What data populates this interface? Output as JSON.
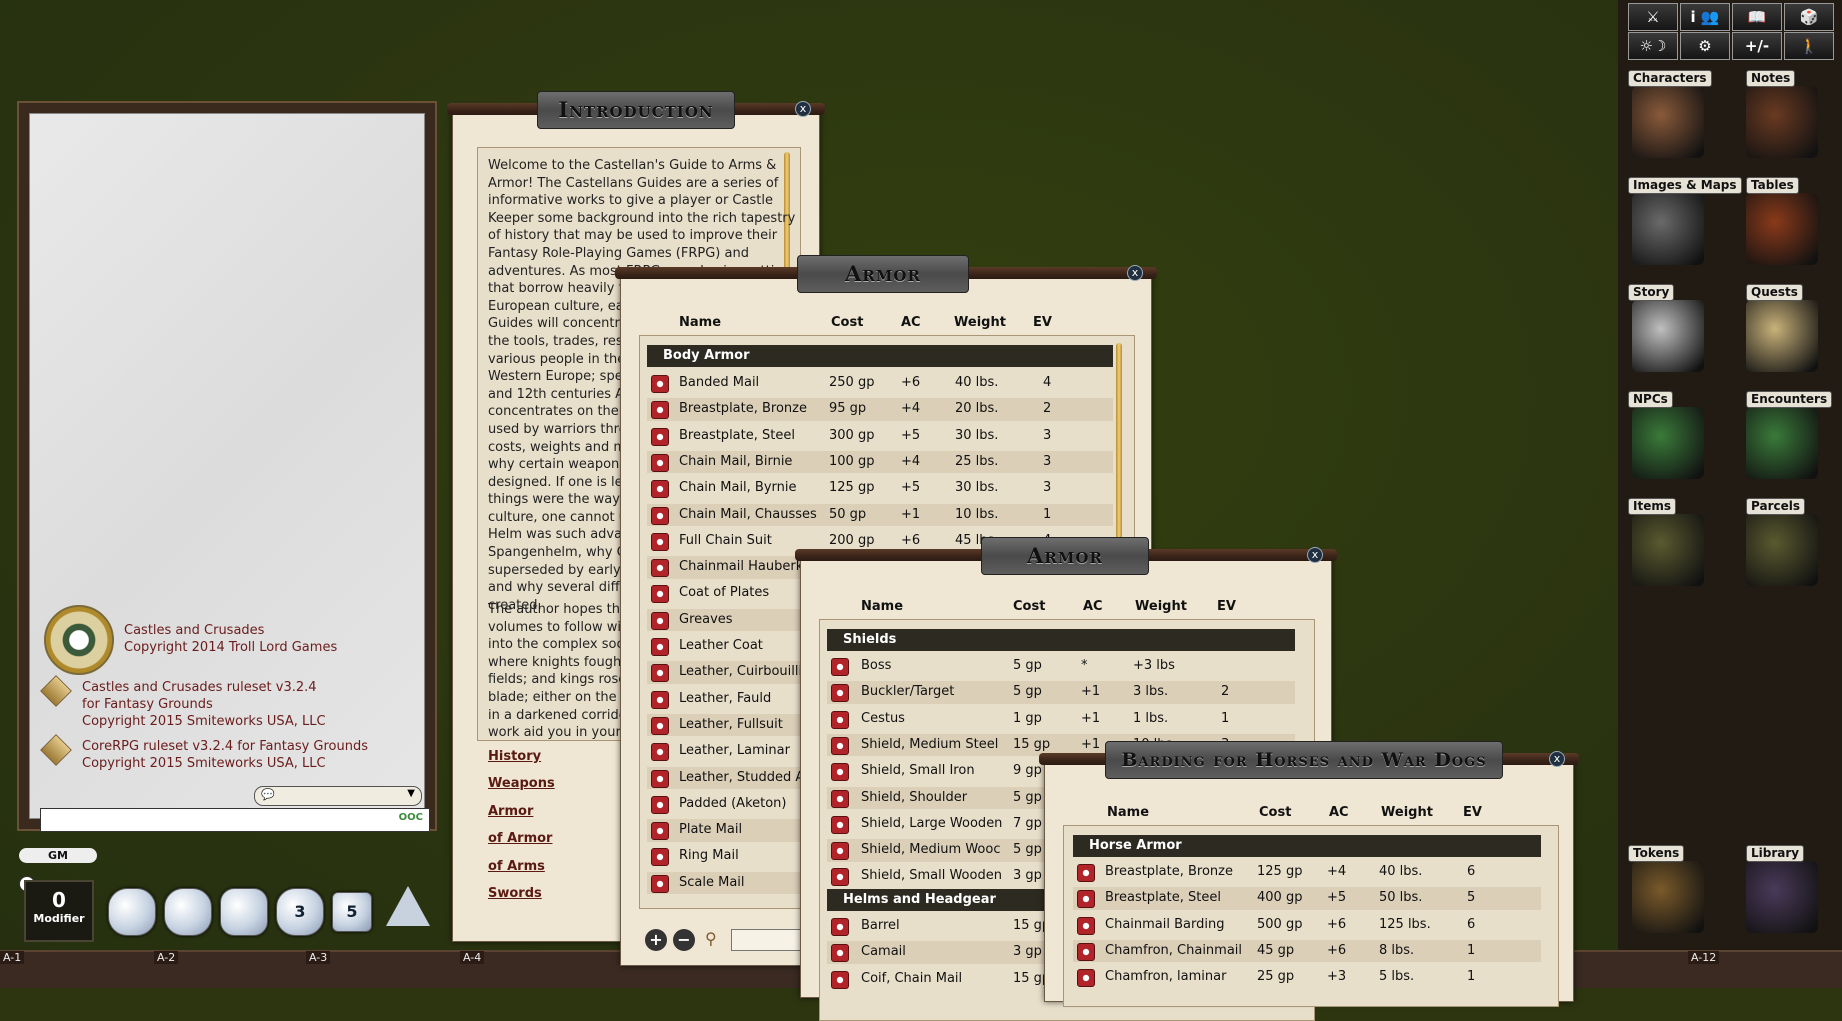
{
  "chat": {
    "messages": [
      {
        "line1": "Castles and Crusades",
        "line2": "Copyright 2014 Troll Lord Games",
        "line3": ""
      },
      {
        "line1": "Castles and Crusades ruleset v3.2.4",
        "line2": "for Fantasy Grounds",
        "line3": "Copyright 2015 Smiteworks USA, LLC"
      },
      {
        "line1": "CoreRPG ruleset v3.2.4 for Fantasy Grounds",
        "line2": "Copyright 2015 Smiteworks USA, LLC",
        "line3": ""
      }
    ],
    "ooc_label": "OOC"
  },
  "gm_label": "GM",
  "modifier": {
    "value": "0",
    "label": "Modifier"
  },
  "dice": [
    {
      "face": ""
    },
    {
      "face": ""
    },
    {
      "face": ""
    },
    {
      "face": "3"
    },
    {
      "face": "5"
    },
    {
      "face": ""
    }
  ],
  "hotbar": [
    "A-1",
    "A-2",
    "A-3",
    "A-4",
    "A-12"
  ],
  "intro": {
    "title": "Introduction",
    "para1": [
      "Welcome to the Castellan's Guide to Arms &",
      "Armor! The Castellans Guides are a series of",
      "informative works to give a player or Castle",
      "Keeper some background into the rich tapestry",
      "of history that may be used to improve their",
      "Fantasy Role-Playing Games (FRPG) and",
      "adventures. As most FRPGs emphasize settings",
      "that borrow heavily fr",
      "European culture, eac",
      "Guides will concentra",
      "the tools, trades, resi",
      "various people in the",
      "Western Europe; spec",
      "and 12th centuries A.",
      "concentrates on the a",
      "used by warriors thro",
      "costs, weights and mo",
      "why certain weapons",
      "designed. If one is lef",
      "things were the way t",
      "culture, one cannot u",
      "Helm was such advan",
      "Spangenhelm, why Ch",
      "superseded by early t",
      "and why several diffe",
      "created."
    ],
    "para2": [
      "The author hopes tha",
      "volumes to follow wil",
      "into the complex soc",
      "where knights fought",
      "fields; and kings rose",
      "blade; either on the b",
      "in a darkened corrido",
      "work aid you in your g"
    ],
    "links": [
      "History",
      "Weapons",
      "Armor",
      "of Armor",
      "of Arms",
      "Swords"
    ]
  },
  "armor": {
    "title": "Armor",
    "headers": [
      "Name",
      "Cost",
      "AC",
      "Weight",
      "EV"
    ],
    "group": "Body Armor",
    "rows": [
      [
        "Banded Mail",
        "250 gp",
        "+6",
        "40 lbs.",
        "4"
      ],
      [
        "Breastplate, Bronze",
        "95 gp",
        "+4",
        "20 lbs.",
        "2"
      ],
      [
        "Breastplate, Steel",
        "300 gp",
        "+5",
        "30 lbs.",
        "3"
      ],
      [
        "Chain Mail, Birnie",
        "100 gp",
        "+4",
        "25 lbs.",
        "3"
      ],
      [
        "Chain Mail, Byrnie",
        "125 gp",
        "+5",
        "30 lbs.",
        "3"
      ],
      [
        "Chain Mail, Chausses",
        "50 gp",
        "+1",
        "10 lbs.",
        "1"
      ],
      [
        "Full Chain Suit",
        "200 gp",
        "+6",
        "45 lbs.",
        "4"
      ],
      [
        "Chainmail Hauberk",
        "",
        "",
        "",
        ""
      ],
      [
        "Coat of Plates",
        "",
        "",
        "",
        ""
      ],
      [
        "Greaves",
        "",
        "",
        "",
        ""
      ],
      [
        "Leather Coat",
        "",
        "",
        "",
        ""
      ],
      [
        "Leather, Cuirbouilli",
        "",
        "",
        "",
        ""
      ],
      [
        "Leather, Fauld",
        "",
        "",
        "",
        ""
      ],
      [
        "Leather, Fullsuit",
        "",
        "",
        "",
        ""
      ],
      [
        "Leather, Laminar",
        "",
        "",
        "",
        ""
      ],
      [
        "Leather, Studded A",
        "",
        "",
        "",
        ""
      ],
      [
        "Padded (Aketon)",
        "",
        "",
        "",
        ""
      ],
      [
        "Plate Mail",
        "",
        "",
        "",
        ""
      ],
      [
        "Ring Mail",
        "",
        "",
        "",
        ""
      ],
      [
        "Scale Mail",
        "",
        "",
        "",
        ""
      ]
    ]
  },
  "shields": {
    "title": "Armor",
    "headers": [
      "Name",
      "Cost",
      "AC",
      "Weight",
      "EV"
    ],
    "group": "Shields",
    "group2": "Helms and Headgear",
    "rows": [
      [
        "Boss",
        "5 gp",
        "*",
        "+3 lbs",
        ""
      ],
      [
        "Buckler/Target",
        "5 gp",
        "+1",
        "3 lbs.",
        "2"
      ],
      [
        "Cestus",
        "1 gp",
        "+1",
        "1 lbs.",
        "1"
      ],
      [
        "Shield, Medium Steel",
        "15 gp",
        "+1",
        "10 lbs.",
        "3"
      ],
      [
        "Shield, Small Iron",
        "9 gp",
        "",
        "",
        ""
      ],
      [
        "Shield, Shoulder",
        "5 gp",
        "",
        "",
        ""
      ],
      [
        "Shield, Large Wooden",
        "7 gp",
        "",
        "",
        ""
      ],
      [
        "Shield, Medium Wooc",
        "5 gp",
        "",
        "",
        ""
      ],
      [
        "Shield, Small Wooden",
        "3 gp",
        "",
        "",
        ""
      ]
    ],
    "rows2": [
      [
        "Barrel",
        "15 gp"
      ],
      [
        "Camail",
        "3 gp"
      ],
      [
        "Coif, Chain Mail",
        "15 gp"
      ]
    ]
  },
  "barding": {
    "title": "Barding for Horses and War Dogs",
    "headers": [
      "Name",
      "Cost",
      "AC",
      "Weight",
      "EV"
    ],
    "group": "Horse Armor",
    "rows": [
      [
        "Breastplate, Bronze",
        "125 gp",
        "+4",
        "40 lbs.",
        "6"
      ],
      [
        "Breastplate, Steel",
        "400 gp",
        "+5",
        "50 lbs.",
        "5"
      ],
      [
        "Chainmail Barding",
        "500 gp",
        "+6",
        "125 lbs.",
        "6"
      ],
      [
        "Chamfron, Chainmail",
        "45 gp",
        "+6",
        "8 lbs.",
        "1"
      ],
      [
        "Chamfron, laminar",
        "25 gp",
        "+3",
        "5 lbs.",
        "1"
      ]
    ]
  },
  "toolbar": [
    "⚔",
    "i 👥",
    "📖",
    "🎲",
    "☼☽",
    "⚙",
    "+/-",
    "🚶"
  ],
  "library": [
    {
      "label": "Characters",
      "color": "#8a5a3a"
    },
    {
      "label": "Notes",
      "color": "#6a3a22"
    },
    {
      "label": "Images & Maps",
      "color": "#6a6a6a"
    },
    {
      "label": "Tables",
      "color": "#8a3a1a"
    },
    {
      "label": "Story",
      "color": "#c0c0c0"
    },
    {
      "label": "Quests",
      "color": "#c9b27a"
    },
    {
      "label": "NPCs",
      "color": "#3a7a3a"
    },
    {
      "label": "Encounters",
      "color": "#3a7a3a"
    },
    {
      "label": "Items",
      "color": "#5a5a30"
    },
    {
      "label": "Parcels",
      "color": "#5a5a30"
    },
    {
      "label": "Tokens",
      "color": "#7a5a2a"
    },
    {
      "label": "Library",
      "color": "#4a3a5a"
    }
  ]
}
